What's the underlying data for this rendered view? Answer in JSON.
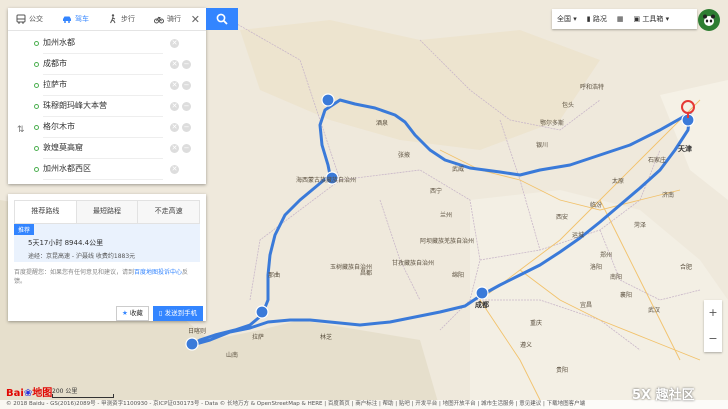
{
  "modes": [
    {
      "label": "公交",
      "icon": "bus-icon",
      "active": false
    },
    {
      "label": "驾车",
      "icon": "car-icon",
      "active": true
    },
    {
      "label": "步行",
      "icon": "walk-icon",
      "active": false
    },
    {
      "label": "骑行",
      "icon": "bike-icon",
      "active": false
    }
  ],
  "stops": [
    "加州水都",
    "成都市",
    "拉萨市",
    "珠穆朗玛峰大本营",
    "格尔木市",
    "敦煌莫高窟",
    "加州水都西区"
  ],
  "result": {
    "tabs": [
      "推荐路线",
      "最短路程",
      "不走高速"
    ],
    "badge": "推荐",
    "time_distance": "5天17小时   8944.4公里",
    "via": "途经：京昆高速 - 沪聂线    收费约1883元",
    "hint_prefix": "百度提醒您：如果您有任何意见和建议，请到",
    "hint_link": "百度地图投诉中心",
    "hint_suffix": "反馈。",
    "favorite": "收藏",
    "send": "发送到手机"
  },
  "toolbar": {
    "region": "全国",
    "traffic": "路况",
    "tools": "工具箱"
  },
  "footer": {
    "logo_a": "Bai",
    "logo_b": "地图",
    "scale": "200 公里",
    "copyright": "© 2018 Baidu - GS(2016)2089号 - 甲测资字1100930 - 京ICP证030173号 - Data © 长地万方 & OpenStreetMap & HERE | 百度首页 | 商户标注 | 帮助 | 贴吧 | 开发平台 | 地图开放平台 | 城市生活服务 | 意见建议 | 下载地图客户端",
    "watermark": "5X 趣社区"
  },
  "map_labels": [
    {
      "t": "天津",
      "big": true
    },
    {
      "t": "石家庄",
      "big": false
    },
    {
      "t": "太原",
      "big": false
    },
    {
      "t": "西宁",
      "big": false
    },
    {
      "t": "兰州",
      "big": false
    },
    {
      "t": "西安",
      "big": false
    },
    {
      "t": "成都",
      "big": true
    },
    {
      "t": "拉萨",
      "big": false
    },
    {
      "t": "重庆",
      "big": false
    },
    {
      "t": "郑州",
      "big": false
    },
    {
      "t": "武汉",
      "big": false
    },
    {
      "t": "贵阳",
      "big": false
    },
    {
      "t": "海西蒙古族藏族自治州",
      "big": false
    },
    {
      "t": "玉树藏族自治州",
      "big": false
    },
    {
      "t": "日喀则",
      "big": false
    },
    {
      "t": "阿里地区",
      "big": false
    },
    {
      "t": "那曲",
      "big": false
    },
    {
      "t": "林芝",
      "big": false
    },
    {
      "t": "山南",
      "big": false
    },
    {
      "t": "昌都",
      "big": false
    },
    {
      "t": "甘孜藏族自治州",
      "big": false
    },
    {
      "t": "阿坝藏族羌族自治州",
      "big": false
    },
    {
      "t": "酒泉",
      "big": false
    },
    {
      "t": "张掖",
      "big": false
    },
    {
      "t": "武威",
      "big": false
    },
    {
      "t": "银川",
      "big": false
    },
    {
      "t": "呼和浩特",
      "big": false
    },
    {
      "t": "包头",
      "big": false
    },
    {
      "t": "鄂尔多斯",
      "big": false
    },
    {
      "t": "临汾",
      "big": false
    },
    {
      "t": "运城",
      "big": false
    },
    {
      "t": "洛阳",
      "big": false
    },
    {
      "t": "南阳",
      "big": false
    },
    {
      "t": "襄阳",
      "big": false
    },
    {
      "t": "宜昌",
      "big": false
    },
    {
      "t": "绵阳",
      "big": false
    },
    {
      "t": "遵义",
      "big": false
    },
    {
      "t": "济南",
      "big": false
    },
    {
      "t": "菏泽",
      "big": false
    },
    {
      "t": "合肥",
      "big": false
    }
  ],
  "zoom": {
    "in": "+",
    "out": "−"
  }
}
